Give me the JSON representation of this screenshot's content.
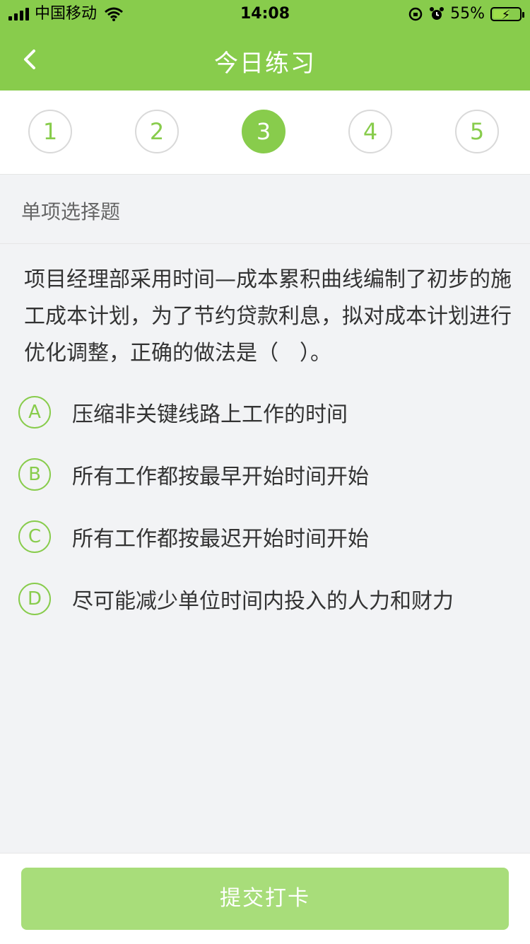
{
  "status": {
    "carrier": "中国移动",
    "time": "14:08",
    "battery": "55%"
  },
  "nav": {
    "title": "今日练习"
  },
  "steps": [
    "1",
    "2",
    "3",
    "4",
    "5"
  ],
  "active_step": 3,
  "question": {
    "type": "单项选择题",
    "text": "项目经理部采用时间—成本累积曲线编制了初步的施工成本计划，为了节约贷款利息，拟对成本计划进行优化调整，正确的做法是（　）。",
    "options": [
      {
        "letter": "A",
        "text": "压缩非关键线路上工作的时间"
      },
      {
        "letter": "B",
        "text": "所有工作都按最早开始时间开始"
      },
      {
        "letter": "C",
        "text": "所有工作都按最迟开始时间开始"
      },
      {
        "letter": "D",
        "text": "尽可能减少单位时间内投入的人力和财力"
      }
    ]
  },
  "footer": {
    "submit_label": "提交打卡"
  },
  "colors": {
    "brand": "#88cc4c",
    "submit_bg": "#a8dd7a"
  }
}
